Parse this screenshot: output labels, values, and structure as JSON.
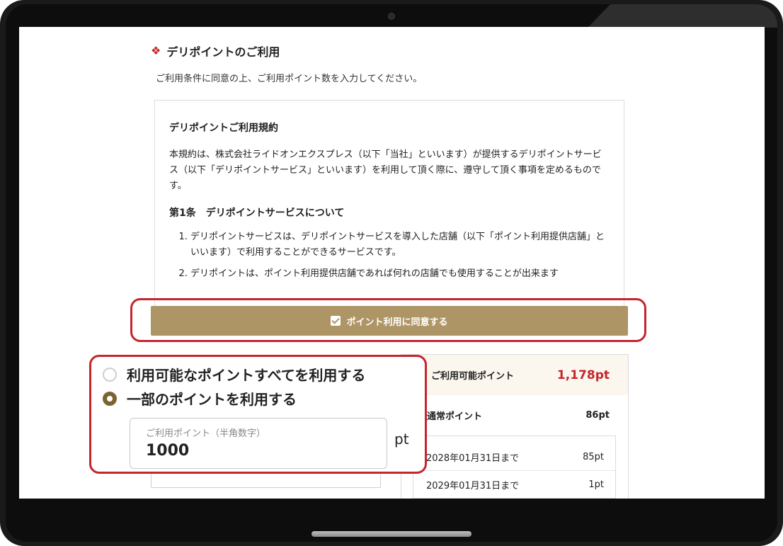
{
  "section": {
    "title": "デリポイントのご利用",
    "bullet_icon": "diamond-icon",
    "intro": "ご利用条件に同意の上、ご利用ポイント数を入力してください。"
  },
  "terms": {
    "title": "デリポイントご利用規約",
    "body": "本規約は、株式会社ライドオンエクスプレス（以下「当社」といいます）が提供するデリポイントサービス（以下「デリポイントサービス」といいます）を利用して頂く際に、遵守して頂く事項を定めるものです。",
    "article1_title": "第1条　デリポイントサービスについて",
    "items": [
      "デリポイントサービスは、デリポイントサービスを導入した店舗（以下「ポイント利用提供店舗」といいます）で利用することができるサービスです。",
      "デリポイントは、ポイント利用提供店舗であれば何れの店舗でも使用することが出来ます"
    ]
  },
  "agree_button": {
    "label": "ポイント利用に同意する",
    "checked": true
  },
  "options": {
    "use_all": "利用可能なポイントすべてを利用する",
    "use_partial": "一部のポイントを利用する",
    "selected": "use_partial",
    "input_label": "ご利用ポイント（半角数字）",
    "input_value": "1000",
    "unit": "pt"
  },
  "points": {
    "available_label": "ご利用可能ポイント",
    "available_value": "1,178pt",
    "normal_label": "通常ポイント",
    "normal_value": "86pt",
    "expirations": [
      {
        "date": "2028年01月31日まで",
        "value": "85pt"
      },
      {
        "date": "2029年01月31日まで",
        "value": "1pt"
      }
    ]
  },
  "colors": {
    "accent_red": "#c4262c",
    "gold": "#ae9566",
    "radio_selected": "#7a6530"
  }
}
